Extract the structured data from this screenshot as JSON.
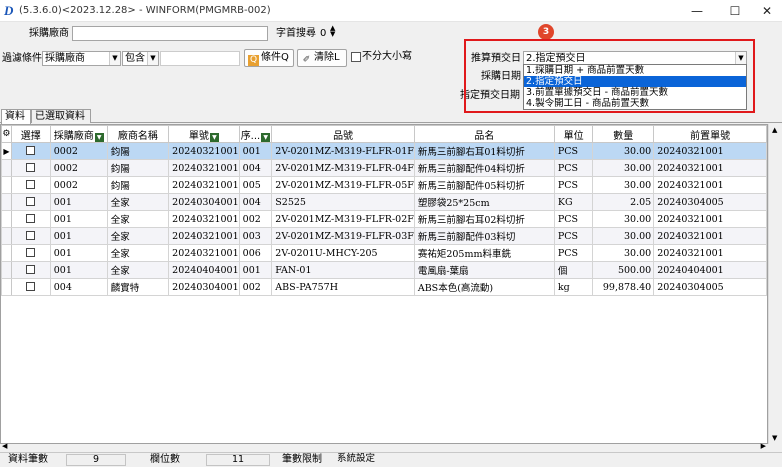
{
  "window": {
    "title": "(5.3.6.0)<2023.12.28> - WINFORM(PMGMRB-002)",
    "minimize": "—",
    "maximize": "☐",
    "close": "✕"
  },
  "filters": {
    "vendor_label": "採購廠商",
    "vendor_value": "",
    "first_n_label": "字首搜尋",
    "first_n_value": "0",
    "filter_label": "過濾條件",
    "filter_field": "採購廠商",
    "filter_op": "包含",
    "filter_value": "",
    "condition_btn": "條件Q",
    "clear_btn": "清除L",
    "case_label": "不分大小寫",
    "calc_date_label": "推算預交日",
    "calc_date_value": "2.指定預交日",
    "purchase_date_label": "採購日期",
    "specified_date_label": "指定預交日期",
    "badge": "3",
    "dropdown_options": [
      "1.採購日期 + 商品前置天數",
      "2.指定預交日",
      "3.前置單據預交日 - 商品前置天數",
      "4.製令開工日 - 商品前置天數"
    ],
    "dropdown_selected": 1
  },
  "tabs": [
    {
      "label": "資料",
      "active": true
    },
    {
      "label": "已選取資料",
      "active": false
    }
  ],
  "table": {
    "columns": [
      "選擇",
      "採購廠商",
      "廠商名稱",
      "單號",
      "序...",
      "品號",
      "品名",
      "單位",
      "數量",
      "前置單號"
    ],
    "sortable": [
      false,
      true,
      false,
      true,
      true,
      false,
      false,
      false,
      false,
      false
    ],
    "rows": [
      [
        "",
        "0002",
        "鈞陽",
        "20240321001",
        "001",
        "2V-0201MZ-M319-FLFR-01F",
        "新馬三前腳右耳01料切折",
        "PCS",
        "30.00",
        "20240321001"
      ],
      [
        "",
        "0002",
        "鈞陽",
        "20240321001",
        "004",
        "2V-0201MZ-M319-FLFR-04F",
        "新馬三前腳配件04料切折",
        "PCS",
        "30.00",
        "20240321001"
      ],
      [
        "",
        "0002",
        "鈞陽",
        "20240321001",
        "005",
        "2V-0201MZ-M319-FLFR-05F",
        "新馬三前腳配件05料切折",
        "PCS",
        "30.00",
        "20240321001"
      ],
      [
        "",
        "001",
        "全家",
        "20240304001",
        "004",
        "S2525",
        "塑膠袋25*25cm",
        "KG",
        "2.05",
        "20240304005"
      ],
      [
        "",
        "001",
        "全家",
        "20240321001",
        "002",
        "2V-0201MZ-M319-FLFR-02F",
        "新馬三前腳右耳02料切折",
        "PCS",
        "30.00",
        "20240321001"
      ],
      [
        "",
        "001",
        "全家",
        "20240321001",
        "003",
        "2V-0201MZ-M319-FLFR-03F",
        "新馬三前腳配件03料切",
        "PCS",
        "30.00",
        "20240321001"
      ],
      [
        "",
        "001",
        "全家",
        "20240321001",
        "006",
        "2V-0201U-MHCY-205",
        "赛祐矩205mm料車銑",
        "PCS",
        "30.00",
        "20240321001"
      ],
      [
        "",
        "001",
        "全家",
        "20240404001",
        "001",
        "FAN-01",
        "電風扇-葉扇",
        "個",
        "500.00",
        "20240404001"
      ],
      [
        "",
        "004",
        "麟實特",
        "20240304001",
        "002",
        "ABS-PA757H",
        "ABS本色(高流動)",
        "kg",
        "99,878.40",
        "20240304005"
      ]
    ],
    "current_row": 0
  },
  "status": {
    "records_label": "資料筆數",
    "records_value": "9",
    "fields_label": "欄位數",
    "fields_value": "11",
    "limit_label": "筆數限制",
    "limit_value": "系統設定"
  }
}
